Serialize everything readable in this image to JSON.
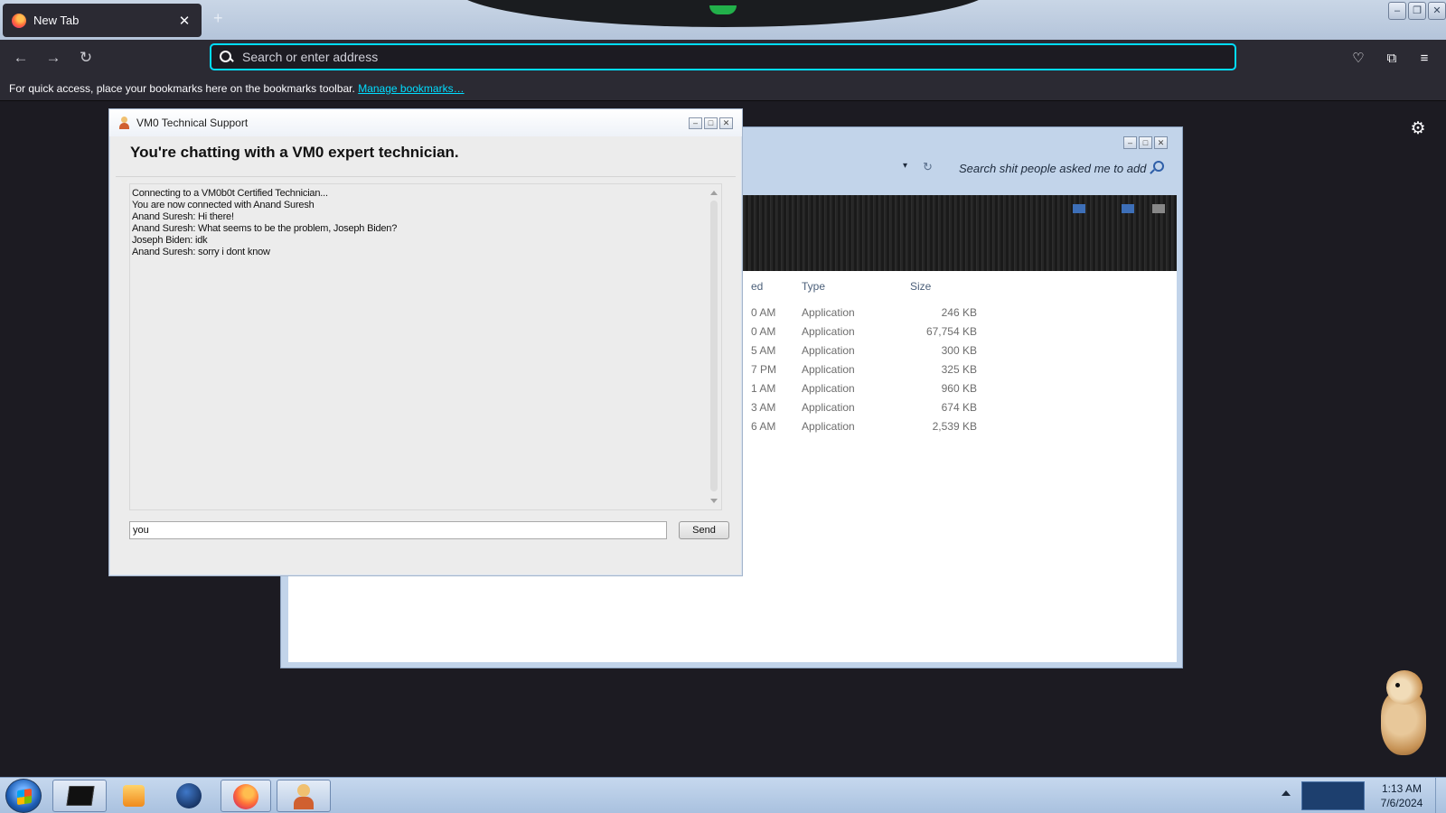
{
  "browser": {
    "tab_title": "New Tab",
    "tab_close": "✕",
    "newtab_plus": "+",
    "nav": {
      "back": "←",
      "forward": "→",
      "reload": "↻"
    },
    "urlbar_placeholder": "Search or enter address",
    "toolbar_icons": {
      "pocket": "♡",
      "extensions": "⧉",
      "menu": "≡"
    },
    "window_controls": {
      "minimize": "–",
      "maximize": "❐",
      "close": "✕"
    },
    "bookmarks_text": "For quick access, place your bookmarks here on the bookmarks toolbar.",
    "bookmarks_link": "Manage bookmarks…",
    "settings_icon": "⚙"
  },
  "chat_window": {
    "title": "VM0 Technical Support",
    "heading": "You're chatting with a VM0 expert technician.",
    "controls": {
      "minimize": "–",
      "maximize": "□",
      "close": "✕"
    },
    "messages": [
      "Connecting to a VM0b0t Certified Technician...",
      "You are now connected with Anand Suresh",
      "Anand Suresh: Hi there!",
      "Anand Suresh: What seems to be the problem, Joseph Biden?",
      "Joseph Biden: idk",
      "Anand Suresh: sorry i dont know"
    ],
    "input_value": "you",
    "send_label": "Send"
  },
  "explorer": {
    "search_placeholder": "Search shit people asked me to add",
    "dropdown_glyph": "▾",
    "refresh_glyph": "↻",
    "controls": {
      "minimize": "–",
      "maximize": "□",
      "close": "✕"
    },
    "columns": {
      "modified_fragment": "ed",
      "type": "Type",
      "size": "Size"
    },
    "files": [
      {
        "time": "0 AM",
        "type": "Application",
        "size": "246 KB"
      },
      {
        "time": "0 AM",
        "type": "Application",
        "size": "67,754 KB"
      },
      {
        "time": "5 AM",
        "type": "Application",
        "size": "300 KB"
      },
      {
        "time": "7 PM",
        "type": "Application",
        "size": "325 KB"
      },
      {
        "time": "1 AM",
        "type": "Application",
        "size": "960 KB"
      },
      {
        "time": "3 AM",
        "type": "Application",
        "size": "674 KB"
      },
      {
        "time": "6 AM",
        "type": "Application",
        "size": "2,539 KB"
      }
    ]
  },
  "taskbar": {
    "clock_time": "1:13 AM",
    "clock_date": "7/6/2024",
    "apps": [
      "terminal-icon",
      "media-player-icon",
      "globe-icon",
      "firefox-icon",
      "support-agent-icon"
    ]
  },
  "colors": {
    "firefox_dark": "#2b2a33",
    "firefox_bg": "#1c1b22",
    "accent_cyan": "#00ddff",
    "taskbar_blue": "#b4cbe6"
  }
}
